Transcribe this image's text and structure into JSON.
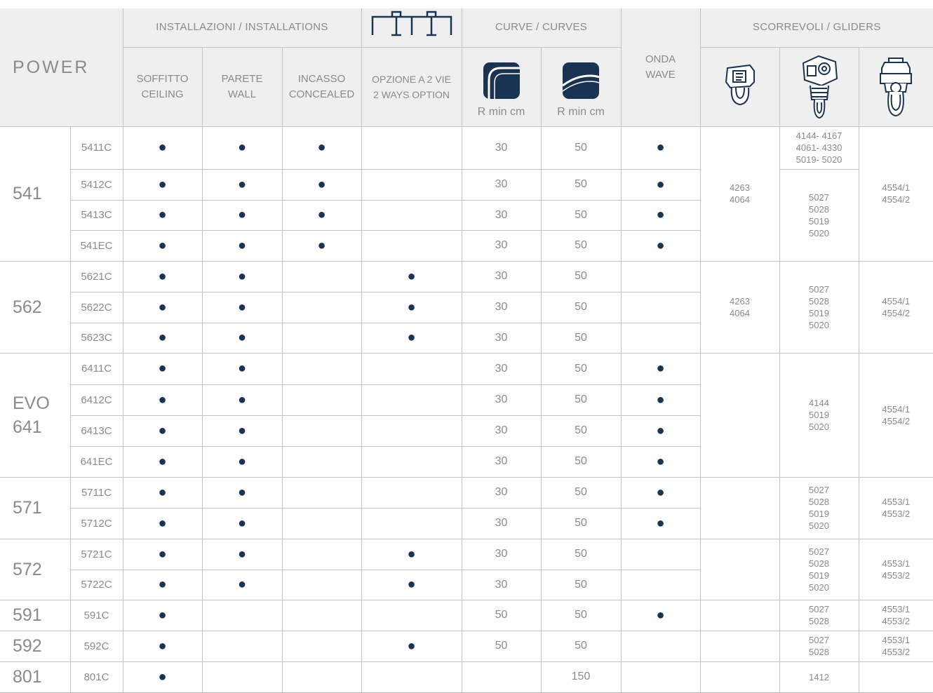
{
  "header": {
    "power": "POWER",
    "installations": "INSTALLAZIONI / INSTALLATIONS",
    "soffitto": [
      "SOFFITTO",
      "CEILING"
    ],
    "parete": [
      "PARETE",
      "WALL"
    ],
    "incasso": [
      "INCASSO",
      "CONCEALED"
    ],
    "two_ways": [
      "OPZIONE A 2 VIE",
      "2 WAYS OPTION"
    ],
    "curves": "CURVE / CURVES",
    "rmin": "R min cm",
    "onda": [
      "ONDA",
      "WAVE"
    ],
    "gliders": "SCORREVOLI / GLIDERS"
  },
  "icons": [
    "two-ways-rail-icon",
    "curve-horizontal-icon",
    "curve-vertical-icon",
    "glider-hook-icon",
    "glider-motor-icon",
    "glider-roller-icon"
  ],
  "colors": {
    "dot": "#1a3352",
    "header_bg": "#efefef",
    "border": "#c4c4c4",
    "text": "#8a8a8a"
  },
  "dot": "●",
  "models": [
    {
      "name": [
        "541"
      ],
      "rows": [
        {
          "code": "5411C",
          "soffitto": true,
          "parete": true,
          "incasso": true,
          "twoways": false,
          "r1": "30",
          "r2": "50",
          "onda": true
        },
        {
          "code": "5412C",
          "soffitto": true,
          "parete": true,
          "incasso": true,
          "twoways": false,
          "r1": "30",
          "r2": "50",
          "onda": true
        },
        {
          "code": "5413C",
          "soffitto": true,
          "parete": true,
          "incasso": true,
          "twoways": false,
          "r1": "30",
          "r2": "50",
          "onda": true
        },
        {
          "code": "541EC",
          "soffitto": true,
          "parete": true,
          "incasso": true,
          "twoways": false,
          "r1": "30",
          "r2": "50",
          "onda": true
        }
      ],
      "g1": [
        "4263",
        "4064"
      ],
      "g2_top": [
        "4144- 4167",
        "4061- 4330",
        "5019- 5020"
      ],
      "g2": [
        "5027",
        "5028",
        "5019",
        "5020"
      ],
      "g3": [
        "4554/1",
        "4554/2"
      ]
    },
    {
      "name": [
        "562"
      ],
      "rows": [
        {
          "code": "5621C",
          "soffitto": true,
          "parete": true,
          "incasso": false,
          "twoways": true,
          "r1": "30",
          "r2": "50",
          "onda": false
        },
        {
          "code": "5622C",
          "soffitto": true,
          "parete": true,
          "incasso": false,
          "twoways": true,
          "r1": "30",
          "r2": "50",
          "onda": false
        },
        {
          "code": "5623C",
          "soffitto": true,
          "parete": true,
          "incasso": false,
          "twoways": true,
          "r1": "30",
          "r2": "50",
          "onda": false
        }
      ],
      "g1": [
        "4263",
        "4064"
      ],
      "g2": [
        "5027",
        "5028",
        "5019",
        "5020"
      ],
      "g3": [
        "4554/1",
        "4554/2"
      ]
    },
    {
      "name": [
        "EVO",
        "641"
      ],
      "rows": [
        {
          "code": "6411C",
          "soffitto": true,
          "parete": true,
          "incasso": false,
          "twoways": false,
          "r1": "30",
          "r2": "50",
          "onda": true
        },
        {
          "code": "6412C",
          "soffitto": true,
          "parete": true,
          "incasso": false,
          "twoways": false,
          "r1": "30",
          "r2": "50",
          "onda": true
        },
        {
          "code": "6413C",
          "soffitto": true,
          "parete": true,
          "incasso": false,
          "twoways": false,
          "r1": "30",
          "r2": "50",
          "onda": true
        },
        {
          "code": "641EC",
          "soffitto": true,
          "parete": true,
          "incasso": false,
          "twoways": false,
          "r1": "30",
          "r2": "50",
          "onda": true
        }
      ],
      "g1": [],
      "g2": [
        "4144",
        "5019",
        "5020"
      ],
      "g3": [
        "4554/1",
        "4554/2"
      ]
    },
    {
      "name": [
        "571"
      ],
      "rows": [
        {
          "code": "5711C",
          "soffitto": true,
          "parete": true,
          "incasso": false,
          "twoways": false,
          "r1": "30",
          "r2": "50",
          "onda": true
        },
        {
          "code": "5712C",
          "soffitto": true,
          "parete": true,
          "incasso": false,
          "twoways": false,
          "r1": "30",
          "r2": "50",
          "onda": true
        }
      ],
      "g1": [],
      "g2": [
        "5027",
        "5028",
        "5019",
        "5020"
      ],
      "g3": [
        "4553/1",
        "4553/2"
      ]
    },
    {
      "name": [
        "572"
      ],
      "rows": [
        {
          "code": "5721C",
          "soffitto": true,
          "parete": true,
          "incasso": false,
          "twoways": true,
          "r1": "30",
          "r2": "50",
          "onda": false
        },
        {
          "code": "5722C",
          "soffitto": true,
          "parete": true,
          "incasso": false,
          "twoways": true,
          "r1": "30",
          "r2": "50",
          "onda": false
        }
      ],
      "g1": [],
      "g2": [
        "5027",
        "5028",
        "5019",
        "5020"
      ],
      "g3": [
        "4553/1",
        "4553/2"
      ]
    },
    {
      "name": [
        "591"
      ],
      "rows": [
        {
          "code": "591C",
          "soffitto": true,
          "parete": false,
          "incasso": false,
          "twoways": false,
          "r1": "50",
          "r2": "50",
          "onda": true
        }
      ],
      "g1": [],
      "g2": [
        "5027",
        "5028"
      ],
      "g3": [
        "4553/1",
        "4553/2"
      ]
    },
    {
      "name": [
        "592"
      ],
      "rows": [
        {
          "code": "592C",
          "soffitto": true,
          "parete": false,
          "incasso": false,
          "twoways": true,
          "r1": "50",
          "r2": "50",
          "onda": false
        }
      ],
      "g1": [],
      "g2": [
        "5027",
        "5028"
      ],
      "g3": [
        "4553/1",
        "4553/2"
      ]
    },
    {
      "name": [
        "801"
      ],
      "rows": [
        {
          "code": "801C",
          "soffitto": true,
          "parete": false,
          "incasso": false,
          "twoways": false,
          "r1": "",
          "r2": "150",
          "onda": false
        }
      ],
      "g1": [],
      "g2": [
        "1412"
      ],
      "g3": []
    }
  ]
}
